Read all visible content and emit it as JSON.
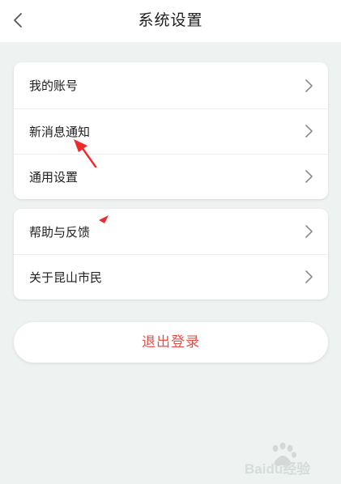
{
  "header": {
    "title": "系统设置",
    "back_icon": "chevron-left-icon"
  },
  "groups": [
    {
      "items": [
        {
          "label": "我的账号",
          "icon": "chevron-right-icon"
        },
        {
          "label": "新消息通知",
          "icon": "chevron-right-icon"
        },
        {
          "label": "通用设置",
          "icon": "chevron-right-icon"
        }
      ]
    },
    {
      "items": [
        {
          "label": "帮助与反馈",
          "icon": "chevron-right-icon"
        },
        {
          "label": "关于昆山市民",
          "icon": "chevron-right-icon"
        }
      ]
    }
  ],
  "logout": {
    "label": "退出登录"
  },
  "colors": {
    "background": "#eef2f1",
    "card": "#ffffff",
    "logout_text": "#e0514a",
    "annotation_red": "#ee2a2a",
    "chevron": "#8a8a8a"
  },
  "watermark": {
    "text": "Baidu经验"
  }
}
